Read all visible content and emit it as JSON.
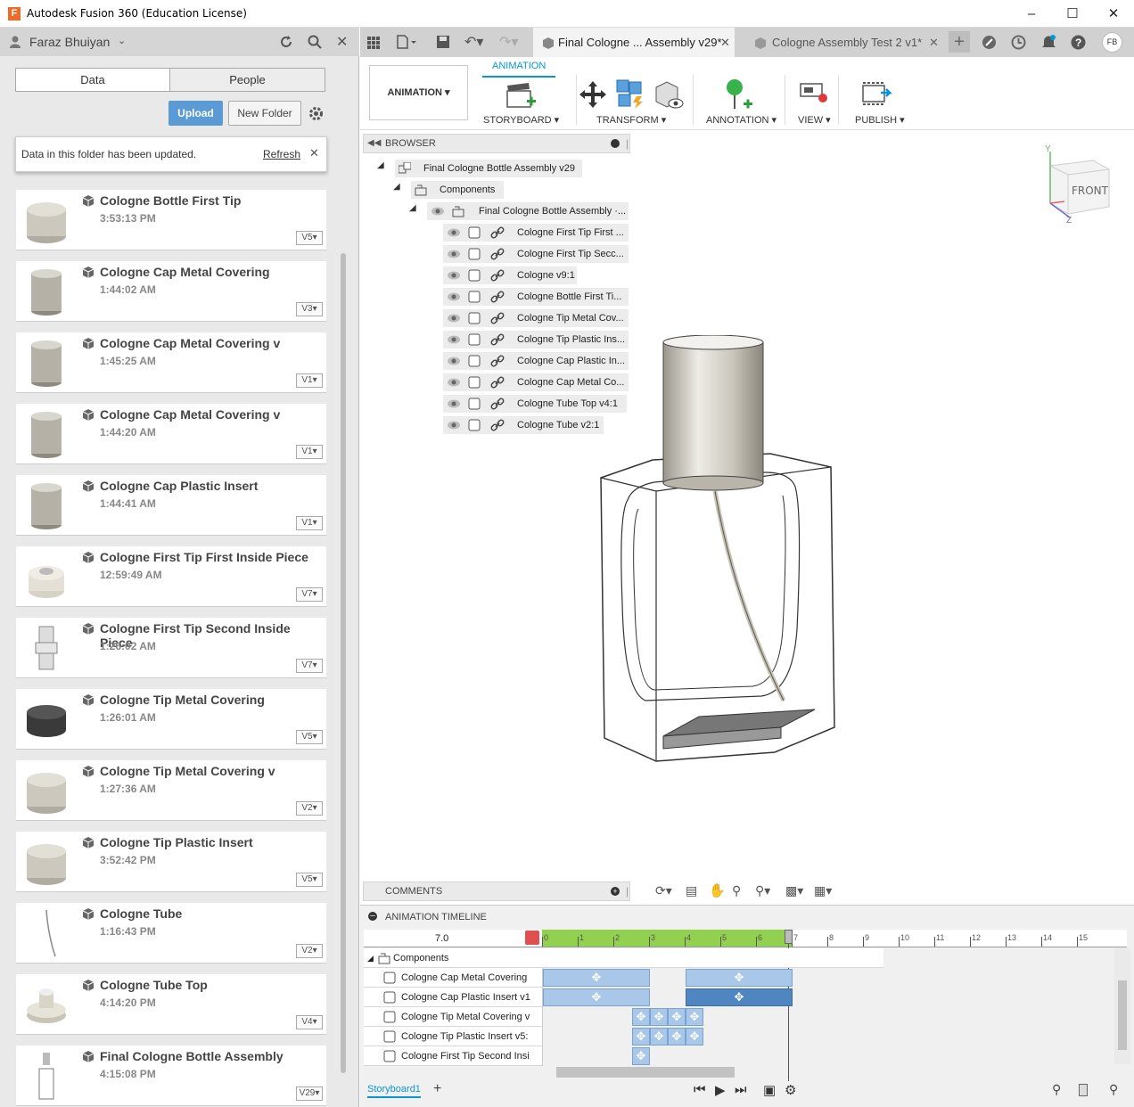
{
  "window": {
    "title": "Autodesk Fusion 360 (Education License)",
    "logo": "F"
  },
  "user": {
    "name": "Faraz Bhuiyan",
    "initials": "FB"
  },
  "panel": {
    "tab_data": "Data",
    "tab_people": "People",
    "upload": "Upload",
    "new_folder": "New Folder",
    "notice": "Data in this folder has been updated.",
    "refresh": "Refresh"
  },
  "files": [
    {
      "name": "Cologne Bottle First Tip",
      "time": "3:53:13 PM",
      "ver": "V5"
    },
    {
      "name": "Cologne Cap Metal Covering",
      "time": "1:44:02 AM",
      "ver": "V3"
    },
    {
      "name": "Cologne Cap Metal Covering v",
      "time": "1:45:25 AM",
      "ver": "V1"
    },
    {
      "name": "Cologne Cap Metal Covering v",
      "time": "1:44:20 AM",
      "ver": "V1"
    },
    {
      "name": "Cologne Cap Plastic Insert",
      "time": "1:44:41 AM",
      "ver": "V1"
    },
    {
      "name": "Cologne First Tip First Inside Piece",
      "time": "12:59:49 AM",
      "ver": "V7"
    },
    {
      "name": "Cologne First Tip Second Inside Piece",
      "time": "1:26:02 AM",
      "ver": "V7"
    },
    {
      "name": "Cologne Tip Metal Covering",
      "time": "1:26:01 AM",
      "ver": "V5"
    },
    {
      "name": "Cologne Tip Metal Covering v",
      "time": "1:27:36 AM",
      "ver": "V2"
    },
    {
      "name": "Cologne Tip Plastic Insert",
      "time": "3:52:42 PM",
      "ver": "V5"
    },
    {
      "name": "Cologne Tube",
      "time": "1:16:43 PM",
      "ver": "V2"
    },
    {
      "name": "Cologne Tube Top",
      "time": "4:14:20 PM",
      "ver": "V4"
    },
    {
      "name": "Final Cologne Bottle Assembly",
      "time": "4:15:08 PM",
      "ver": "V29"
    }
  ],
  "tabs": [
    {
      "label": "Final Cologne ... Assembly v29*"
    },
    {
      "label": "Cologne Assembly Test 2 v1*"
    }
  ],
  "toolbar": {
    "workspace": "ANIMATION",
    "tab": "ANIMATION",
    "storyboard": "STORYBOARD",
    "transform": "TRANSFORM",
    "annotation": "ANNOTATION",
    "view": "VIEW",
    "publish": "PUBLISH"
  },
  "browser": {
    "header": "BROWSER",
    "root": "Final Cologne Bottle Assembly v29",
    "components": "Components",
    "assembly": "Final Cologne Bottle Assembly ·...",
    "items": [
      "Cologne First Tip First ...",
      "Cologne First Tip Secc...",
      "Cologne v9:1",
      "Cologne Bottle First Ti...",
      "Cologne Tip Metal Cov...",
      "Cologne Tip Plastic Ins...",
      "Cologne Cap Plastic In...",
      "Cologne Cap Metal Co...",
      "Cologne Tube Top v4:1",
      "Cologne Tube v2:1"
    ]
  },
  "viewcube": {
    "face": "FRONT",
    "axis_y": "Y",
    "axis_z": "Z"
  },
  "comments": {
    "header": "COMMENTS"
  },
  "timeline": {
    "header": "ANIMATION TIMELINE",
    "time": "7.0",
    "group": "Components",
    "rows": [
      "Cologne Cap Metal Covering",
      "Cologne Cap Plastic Insert v1",
      "Cologne Tip Metal Covering v",
      "Cologne Tip Plastic Insert v5:",
      "Cologne First Tip Second Insi"
    ],
    "ticks": [
      "0",
      "1",
      "2",
      "3",
      "4",
      "5",
      "6",
      "7",
      "8",
      "9",
      "10",
      "11",
      "12",
      "13",
      "14",
      "15"
    ],
    "storyboard": "Storyboard1"
  },
  "colors": {
    "accent": "#0696d7",
    "upload": "#5b9bd5",
    "block": "#a9c7e8",
    "block_dark": "#4f86c2",
    "ruler_green": "#92d050"
  }
}
